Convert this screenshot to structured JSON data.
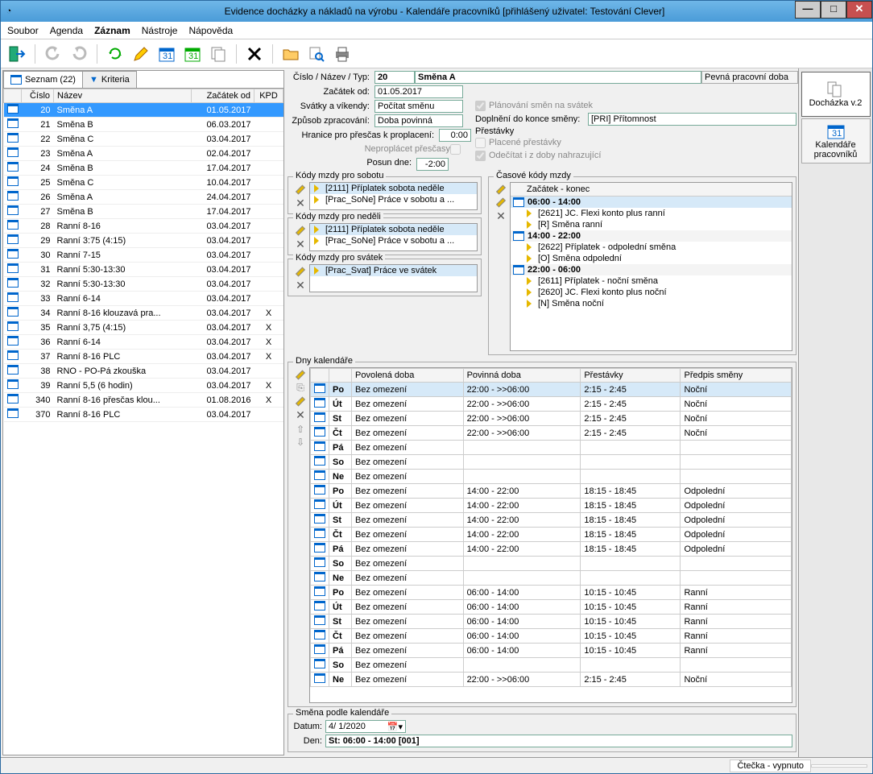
{
  "title": "Evidence docházky a nákladů na výrobu - Kalendáře pracovníků [přihlášený uživatel: Testování Clever]",
  "menu": {
    "soubor": "Soubor",
    "agenda": "Agenda",
    "zaznam": "Záznam",
    "nastroje": "Nástroje",
    "napoveda": "Nápověda"
  },
  "rightTabs": {
    "dochazka": "Docházka v.2",
    "kalendare": "Kalendáře pracovníků"
  },
  "leftTabs": {
    "seznam": "Seznam (22)",
    "kriteria": "Kriteria"
  },
  "listCols": {
    "cislo": "Číslo",
    "nazev": "Název",
    "zacatek": "Začátek od",
    "kpd": "KPD"
  },
  "list": [
    {
      "c": "20",
      "n": "Směna A",
      "z": "01.05.2017",
      "k": "",
      "sel": true
    },
    {
      "c": "21",
      "n": "Směna B",
      "z": "06.03.2017",
      "k": ""
    },
    {
      "c": "22",
      "n": "Směna C",
      "z": "03.04.2017",
      "k": ""
    },
    {
      "c": "23",
      "n": "Směna A",
      "z": "02.04.2017",
      "k": ""
    },
    {
      "c": "24",
      "n": "Směna B",
      "z": "17.04.2017",
      "k": ""
    },
    {
      "c": "25",
      "n": "Směna C",
      "z": "10.04.2017",
      "k": ""
    },
    {
      "c": "26",
      "n": "Směna A",
      "z": "24.04.2017",
      "k": ""
    },
    {
      "c": "27",
      "n": "Směna B",
      "z": "17.04.2017",
      "k": ""
    },
    {
      "c": "28",
      "n": "Ranní 8-16",
      "z": "03.04.2017",
      "k": ""
    },
    {
      "c": "29",
      "n": "Ranní 3:75 (4:15)",
      "z": "03.04.2017",
      "k": ""
    },
    {
      "c": "30",
      "n": "Ranní 7-15",
      "z": "03.04.2017",
      "k": ""
    },
    {
      "c": "31",
      "n": "Ranní 5:30-13:30",
      "z": "03.04.2017",
      "k": ""
    },
    {
      "c": "32",
      "n": "Ranní 5:30-13:30",
      "z": "03.04.2017",
      "k": ""
    },
    {
      "c": "33",
      "n": "Ranní 6-14",
      "z": "03.04.2017",
      "k": ""
    },
    {
      "c": "34",
      "n": "Ranní 8-16 klouzavá pra...",
      "z": "03.04.2017",
      "k": "X"
    },
    {
      "c": "35",
      "n": "Ranní 3,75  (4:15)",
      "z": "03.04.2017",
      "k": "X"
    },
    {
      "c": "36",
      "n": "Ranní 6-14",
      "z": "03.04.2017",
      "k": "X"
    },
    {
      "c": "37",
      "n": "Ranní 8-16 PLC",
      "z": "03.04.2017",
      "k": "X"
    },
    {
      "c": "38",
      "n": "RNO - PO-Pá zkouška",
      "z": "03.04.2017",
      "k": ""
    },
    {
      "c": "39",
      "n": "Ranní 5,5  (6 hodin)",
      "z": "03.04.2017",
      "k": "X"
    },
    {
      "c": "340",
      "n": "Ranní 8-16  přesčas klou...",
      "z": "01.08.2016",
      "k": "X"
    },
    {
      "c": "370",
      "n": "Ranní 8-16  PLC",
      "z": "03.04.2017",
      "k": ""
    }
  ],
  "header": {
    "lbl_cnt": "Číslo / Název / Typ:",
    "cislo": "20",
    "nazev": "Směna A",
    "typ": "Pevná pracovní doba",
    "lbl_zac": "Začátek od:",
    "zac": "01.05.2017",
    "lbl_sv": "Svátky a víkendy:",
    "sv": "Počítat směnu",
    "lbl_zp": "Způsob zpracování:",
    "zp": "Doba povinná",
    "lbl_hp": "Hranice pro přesčas k proplacení:",
    "hp": "0:00",
    "lbl_np": "Neproplácet přesčasy",
    "lbl_pd": "Posun dne:",
    "pd": "-2:00",
    "chk_plan": "Plánování směn na svátek",
    "lbl_dop": "Doplnění do konce směny:",
    "dop": "[PRI] Přítomnost",
    "lbl_pre": "Přestávky",
    "chk_plac": "Placené přestávky",
    "chk_ode": "Odečítat i z doby nahrazující"
  },
  "grpSobota": {
    "title": "Kódy mzdy pro sobotu",
    "items": [
      "[2111] Příplatek sobota neděle",
      "[Prac_SoNe] Práce v sobotu a ..."
    ]
  },
  "grpNedele": {
    "title": "Kódy mzdy pro neděli",
    "items": [
      "[2111] Příplatek sobota neděle",
      "[Prac_SoNe] Práce v sobotu a ..."
    ]
  },
  "grpSvatek": {
    "title": "Kódy mzdy pro svátek",
    "items": [
      "[Prac_Svat] Práce ve svátek"
    ]
  },
  "grpTime": {
    "title": "Časové kódy mzdy",
    "hdr": "Začátek - konec",
    "blocks": [
      {
        "time": "06:00 - 14:00",
        "sel": true,
        "items": [
          "[2621] JC. Flexi konto plus ranní",
          "[R] Směna ranní"
        ]
      },
      {
        "time": "14:00 - 22:00",
        "items": [
          "[2622] Příplatek - odpolední směna",
          "[O] Směna odpolední"
        ]
      },
      {
        "time": "22:00 - 06:00",
        "items": [
          "[2611] Příplatek - noční směna",
          "[2620] JC. Flexi konto plus noční",
          "[N] Směna noční"
        ]
      }
    ]
  },
  "dny": {
    "title": "Dny kalendáře",
    "cols": {
      "c1": "",
      "c2": "Povolená doba",
      "c3": "Povinná doba",
      "c4": "Přestávky",
      "c5": "Předpis směny"
    },
    "rows": [
      {
        "d": "Po",
        "p": "Bez omezení",
        "pv": "22:00 - >>06:00",
        "pr": "2:15 - 2:45",
        "ps": "Noční",
        "sel": true
      },
      {
        "d": "Út",
        "p": "Bez omezení",
        "pv": "22:00 - >>06:00",
        "pr": "2:15 - 2:45",
        "ps": "Noční"
      },
      {
        "d": "St",
        "p": "Bez omezení",
        "pv": "22:00 - >>06:00",
        "pr": "2:15 - 2:45",
        "ps": "Noční"
      },
      {
        "d": "Čt",
        "p": "Bez omezení",
        "pv": "22:00 - >>06:00",
        "pr": "2:15 - 2:45",
        "ps": "Noční"
      },
      {
        "d": "Pá",
        "p": "Bez omezení",
        "pv": "",
        "pr": "",
        "ps": ""
      },
      {
        "d": "So",
        "p": "Bez omezení",
        "pv": "",
        "pr": "",
        "ps": ""
      },
      {
        "d": "Ne",
        "p": "Bez omezení",
        "pv": "",
        "pr": "",
        "ps": ""
      },
      {
        "d": "Po",
        "p": "Bez omezení",
        "pv": "14:00 - 22:00",
        "pr": "18:15 - 18:45",
        "ps": "Odpolední"
      },
      {
        "d": "Út",
        "p": "Bez omezení",
        "pv": "14:00 - 22:00",
        "pr": "18:15 - 18:45",
        "ps": "Odpolední"
      },
      {
        "d": "St",
        "p": "Bez omezení",
        "pv": "14:00 - 22:00",
        "pr": "18:15 - 18:45",
        "ps": "Odpolední"
      },
      {
        "d": "Čt",
        "p": "Bez omezení",
        "pv": "14:00 - 22:00",
        "pr": "18:15 - 18:45",
        "ps": "Odpolední"
      },
      {
        "d": "Pá",
        "p": "Bez omezení",
        "pv": "14:00 - 22:00",
        "pr": "18:15 - 18:45",
        "ps": "Odpolední"
      },
      {
        "d": "So",
        "p": "Bez omezení",
        "pv": "",
        "pr": "",
        "ps": ""
      },
      {
        "d": "Ne",
        "p": "Bez omezení",
        "pv": "",
        "pr": "",
        "ps": ""
      },
      {
        "d": "Po",
        "p": "Bez omezení",
        "pv": "06:00 - 14:00",
        "pr": "10:15 - 10:45",
        "ps": "Ranní"
      },
      {
        "d": "Út",
        "p": "Bez omezení",
        "pv": "06:00 - 14:00",
        "pr": "10:15 - 10:45",
        "ps": "Ranní"
      },
      {
        "d": "St",
        "p": "Bez omezení",
        "pv": "06:00 - 14:00",
        "pr": "10:15 - 10:45",
        "ps": "Ranní"
      },
      {
        "d": "Čt",
        "p": "Bez omezení",
        "pv": "06:00 - 14:00",
        "pr": "10:15 - 10:45",
        "ps": "Ranní"
      },
      {
        "d": "Pá",
        "p": "Bez omezení",
        "pv": "06:00 - 14:00",
        "pr": "10:15 - 10:45",
        "ps": "Ranní"
      },
      {
        "d": "So",
        "p": "Bez omezení",
        "pv": "",
        "pr": "",
        "ps": ""
      },
      {
        "d": "Ne",
        "p": "Bez omezení",
        "pv": "22:00 - >>06:00",
        "pr": "2:15 - 2:45",
        "ps": "Noční"
      }
    ]
  },
  "smena": {
    "title": "Směna podle kalendáře",
    "lbl_datum": "Datum:",
    "datum": "4/ 1/2020",
    "lbl_den": "Den:",
    "den": "St: 06:00 - 14:00  [001]"
  },
  "status": {
    "ctecka": "Čtečka - vypnuto"
  }
}
